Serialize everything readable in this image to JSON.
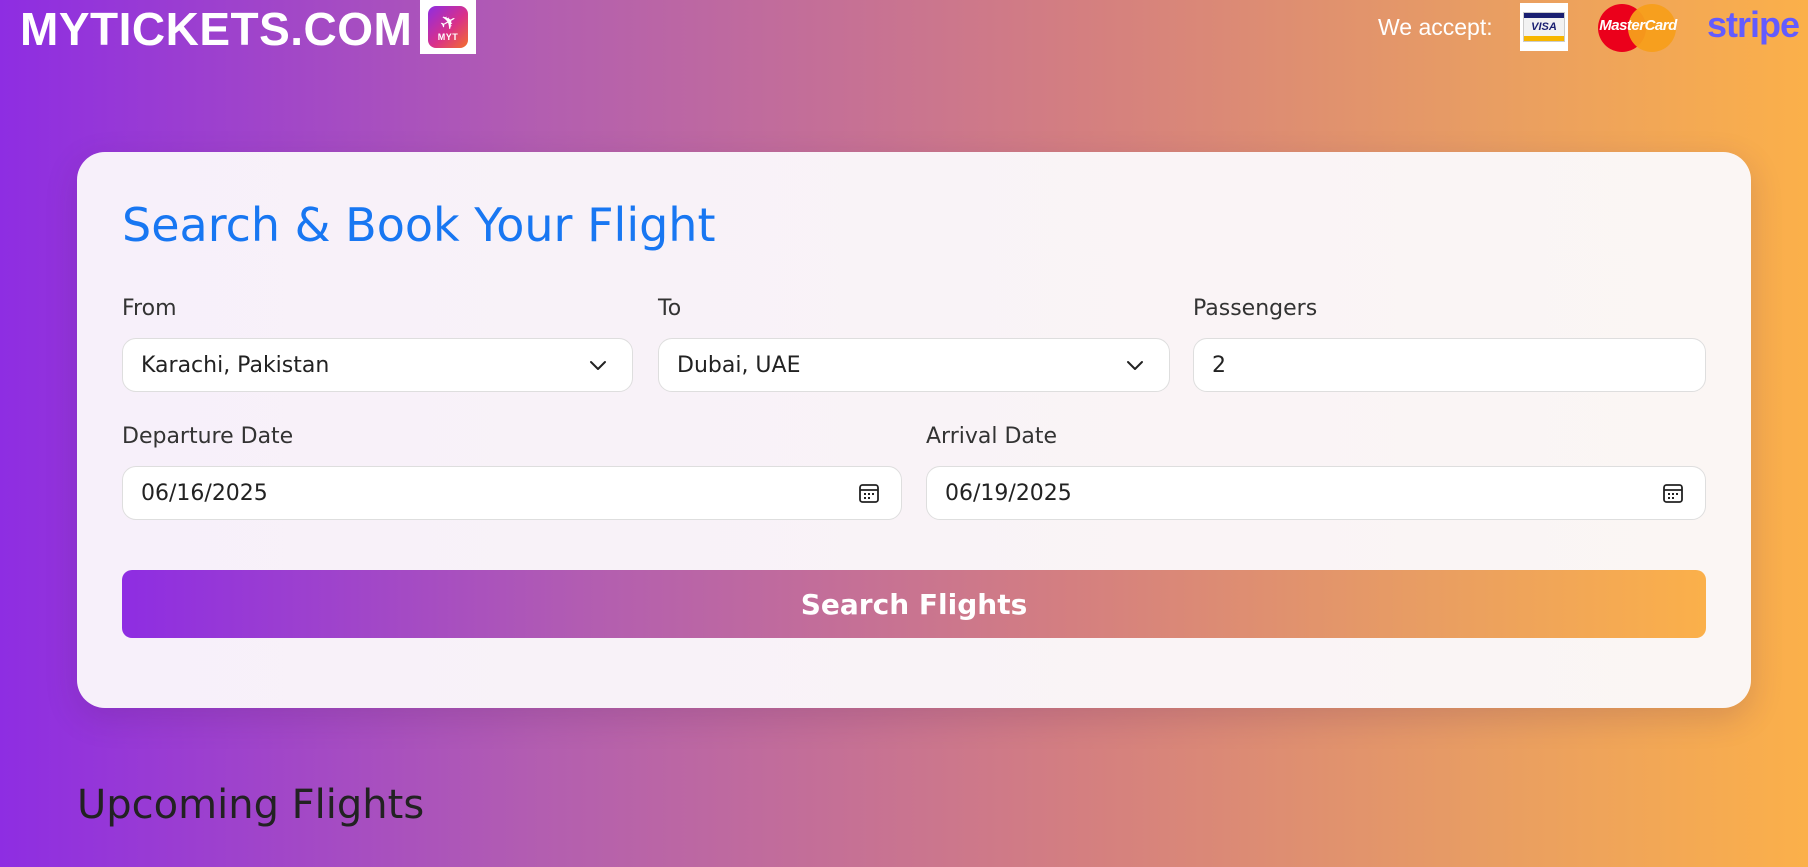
{
  "header": {
    "brand": "MYTICKETS.COM",
    "logo_text": "MYT",
    "accept_label": "We accept:",
    "payment_methods": [
      {
        "name": "VISA",
        "icon": "visa-logo"
      },
      {
        "name": "MasterCard",
        "icon": "mastercard-logo"
      },
      {
        "name": "stripe",
        "icon": "stripe-logo"
      }
    ]
  },
  "search_form": {
    "title": "Search & Book Your Flight",
    "from": {
      "label": "From",
      "value": "Karachi, Pakistan"
    },
    "to": {
      "label": "To",
      "value": "Dubai, UAE"
    },
    "passengers": {
      "label": "Passengers",
      "value": "2"
    },
    "departure": {
      "label": "Departure Date",
      "value": "06/16/2025"
    },
    "arrival": {
      "label": "Arrival Date",
      "value": "06/19/2025"
    },
    "submit_label": "Search Flights"
  },
  "upcoming": {
    "title": "Upcoming Flights"
  },
  "colors": {
    "gradient_start": "#8e2de2",
    "gradient_end": "#fbb04a",
    "title_blue": "#1877f2",
    "stripe_purple": "#635bff"
  }
}
